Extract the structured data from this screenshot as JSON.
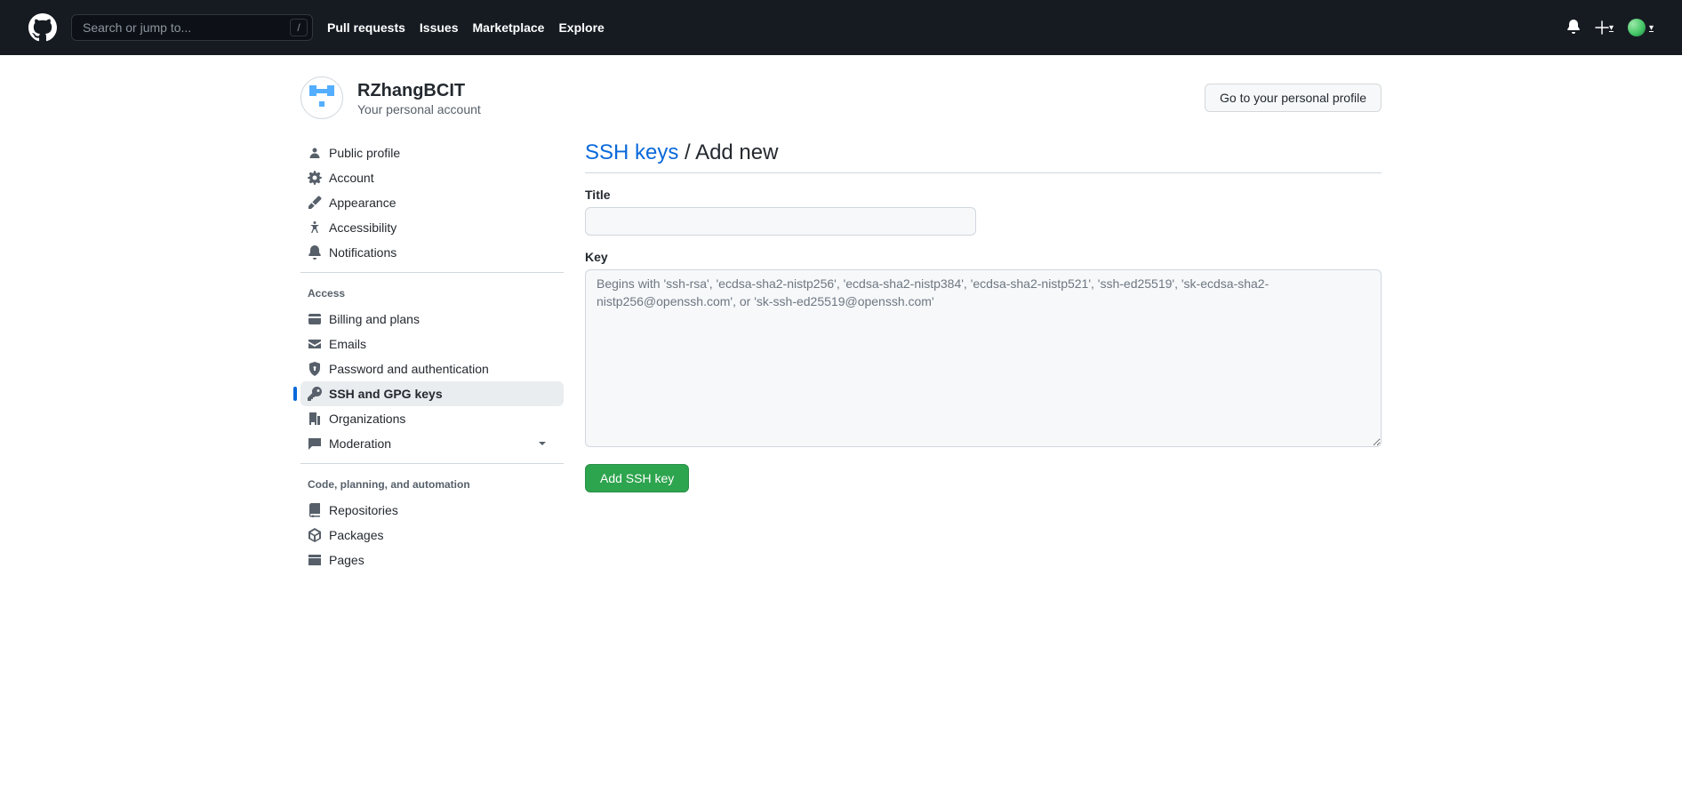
{
  "header": {
    "search_placeholder": "Search or jump to...",
    "slash": "/",
    "nav": {
      "pull_requests": "Pull requests",
      "issues": "Issues",
      "marketplace": "Marketplace",
      "explore": "Explore"
    }
  },
  "profile": {
    "username": "RZhangBCIT",
    "subtitle": "Your personal account",
    "go_to_profile_btn": "Go to your personal profile"
  },
  "sidebar": {
    "group1": {
      "public_profile": "Public profile",
      "account": "Account",
      "appearance": "Appearance",
      "accessibility": "Accessibility",
      "notifications": "Notifications"
    },
    "access_title": "Access",
    "access": {
      "billing": "Billing and plans",
      "emails": "Emails",
      "password": "Password and authentication",
      "ssh": "SSH and GPG keys",
      "organizations": "Organizations",
      "moderation": "Moderation"
    },
    "code_title": "Code, planning, and automation",
    "code": {
      "repositories": "Repositories",
      "packages": "Packages",
      "pages": "Pages"
    }
  },
  "main": {
    "breadcrumb_link": "SSH keys",
    "breadcrumb_sep": " / ",
    "breadcrumb_current": "Add new",
    "title_label": "Title",
    "title_value": "",
    "key_label": "Key",
    "key_value": "",
    "key_placeholder": "Begins with 'ssh-rsa', 'ecdsa-sha2-nistp256', 'ecdsa-sha2-nistp384', 'ecdsa-sha2-nistp521', 'ssh-ed25519', 'sk-ecdsa-sha2-nistp256@openssh.com', or 'sk-ssh-ed25519@openssh.com'",
    "submit_label": "Add SSH key"
  }
}
